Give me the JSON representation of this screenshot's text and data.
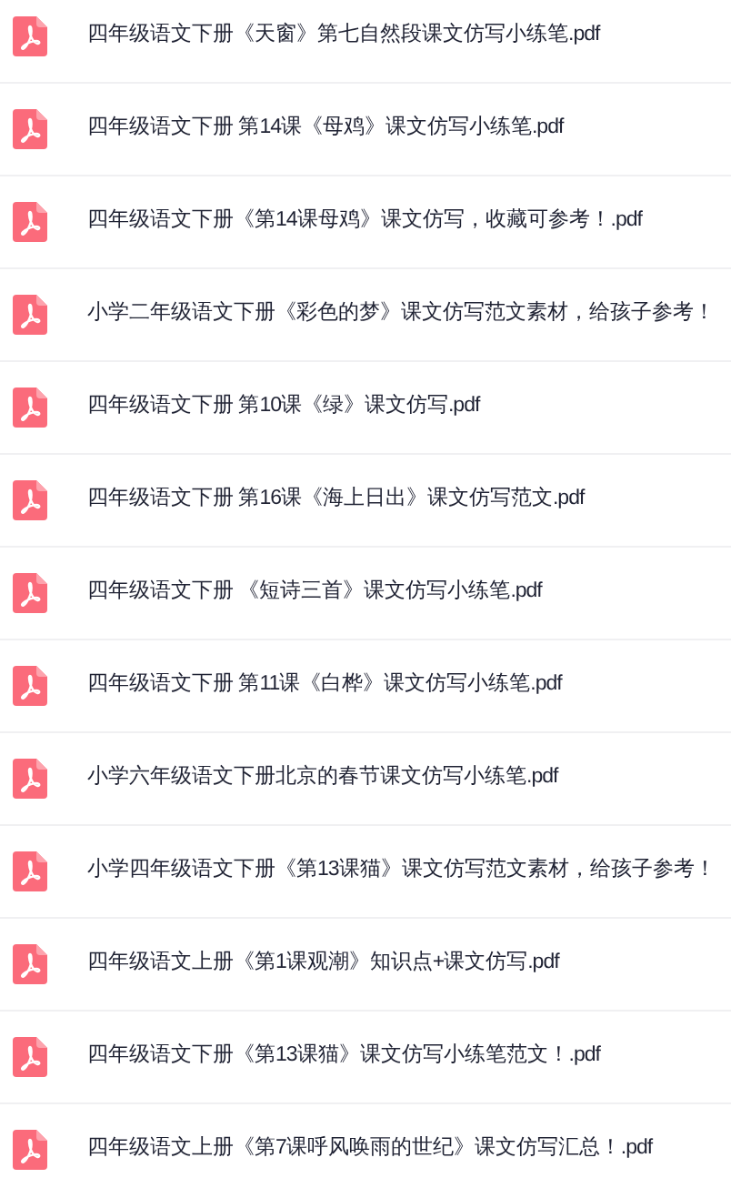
{
  "files": [
    {
      "name": "四年级语文下册《天窗》第七自然段课文仿写小练笔.pdf"
    },
    {
      "name": "四年级语文下册 第14课《母鸡》课文仿写小练笔.pdf"
    },
    {
      "name": "四年级语文下册《第14课母鸡》课文仿写，收藏可参考！.pdf"
    },
    {
      "name": "小学二年级语文下册《彩色的梦》课文仿写范文素材，给孩子参考！"
    },
    {
      "name": "四年级语文下册 第10课《绿》课文仿写.pdf"
    },
    {
      "name": "四年级语文下册 第16课《海上日出》课文仿写范文.pdf"
    },
    {
      "name": "四年级语文下册 《短诗三首》课文仿写小练笔.pdf"
    },
    {
      "name": "四年级语文下册 第11课《白桦》课文仿写小练笔.pdf"
    },
    {
      "name": "小学六年级语文下册北京的春节课文仿写小练笔.pdf"
    },
    {
      "name": "小学四年级语文下册《第13课猫》课文仿写范文素材，给孩子参考！"
    },
    {
      "name": "四年级语文上册《第1课观潮》知识点+课文仿写.pdf"
    },
    {
      "name": "四年级语文下册《第13课猫》课文仿写小练笔范文！.pdf"
    },
    {
      "name": "四年级语文上册《第7课呼风唤雨的世纪》课文仿写汇总！.pdf"
    }
  ]
}
